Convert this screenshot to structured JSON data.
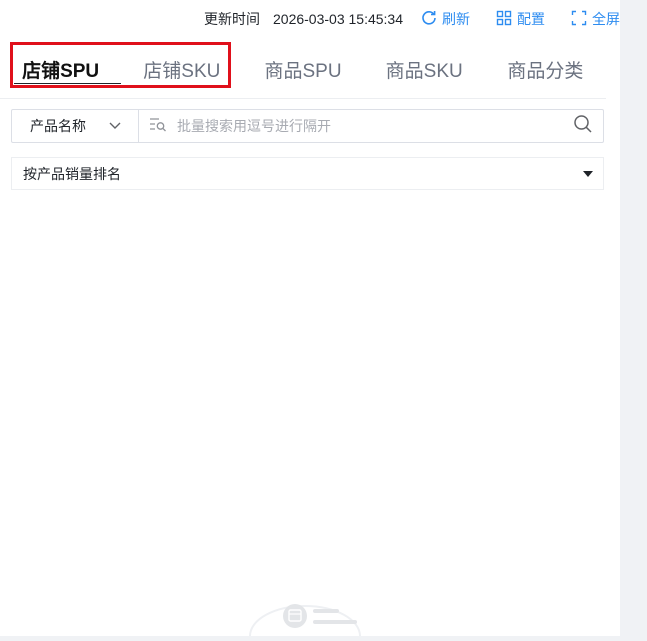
{
  "toolbar": {
    "update_label": "更新时间",
    "update_time": "2026-03-03 15:45:34",
    "refresh_label": "刷新",
    "config_label": "配置",
    "fullscreen_label": "全屏",
    "accent_color": "#2d8cf0"
  },
  "tabs": [
    {
      "label": "店铺SPU",
      "active": true
    },
    {
      "label": "店铺SKU",
      "active": false
    },
    {
      "label": "商品SPU",
      "active": false
    },
    {
      "label": "商品SKU",
      "active": false
    },
    {
      "label": "商品分类",
      "active": false
    }
  ],
  "highlight_color": "#e0101b",
  "search": {
    "field_select": "产品名称",
    "placeholder": "批量搜索用逗号进行隔开",
    "value": ""
  },
  "sort": {
    "selected": "按产品销量排名"
  }
}
